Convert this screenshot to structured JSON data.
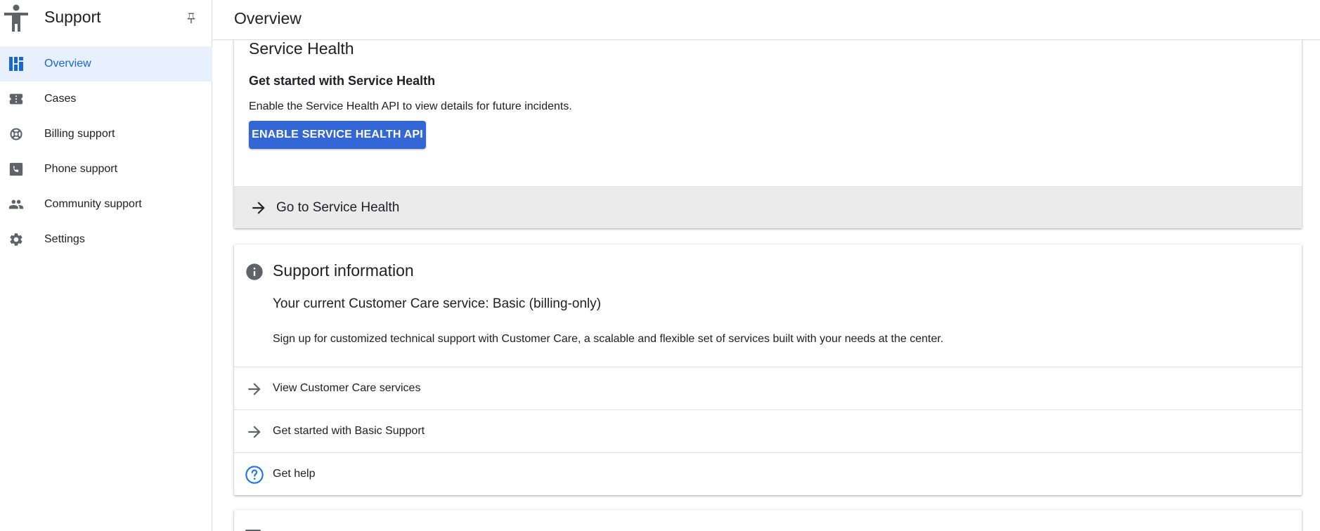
{
  "app": {
    "title": "Support",
    "page_title": "Overview"
  },
  "sidebar": {
    "items": [
      {
        "label": "Overview",
        "icon": "dashboard-icon",
        "active": true
      },
      {
        "label": "Cases",
        "icon": "ticket-icon",
        "active": false
      },
      {
        "label": "Billing support",
        "icon": "lifebuoy-icon",
        "active": false
      },
      {
        "label": "Phone support",
        "icon": "phone-icon",
        "active": false
      },
      {
        "label": "Community support",
        "icon": "people-icon",
        "active": false
      },
      {
        "label": "Settings",
        "icon": "gear-icon",
        "active": false
      }
    ]
  },
  "service_health": {
    "title": "Service Health",
    "subtitle": "Get started with Service Health",
    "description": "Enable the Service Health API to view details for future incidents.",
    "enable_button": "ENABLE SERVICE HEALTH API",
    "goto_link": "Go to Service Health"
  },
  "support_info": {
    "title": "Support information",
    "current_service": "Your current Customer Care service: Basic (billing-only)",
    "description": "Sign up for customized technical support with Customer Care, a scalable and flexible set of services built with your needs at the center.",
    "links": [
      {
        "label": "View Customer Care services",
        "icon": "arrow-right-icon"
      },
      {
        "label": "Get started with Basic Support",
        "icon": "arrow-right-icon"
      },
      {
        "label": "Get help",
        "icon": "help-circle-icon"
      }
    ]
  },
  "colors": {
    "accent": "#1967d2",
    "button": "#3367d6",
    "active_bg": "#e8f0fe",
    "icon": "#5f6368"
  }
}
